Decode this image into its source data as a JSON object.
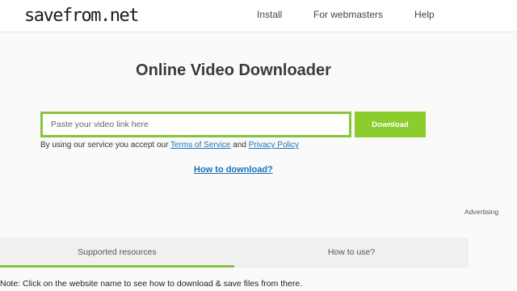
{
  "header": {
    "logo": "savefrom.net",
    "nav": {
      "install": "Install",
      "webmasters": "For webmasters",
      "help": "Help"
    }
  },
  "main": {
    "title": "Online Video Downloader",
    "input": {
      "placeholder": "Paste your video link here",
      "value": ""
    },
    "download_label": "Download",
    "terms": {
      "prefix": "By using our service you accept our",
      "terms_link": "Terms of Service",
      "and": "and",
      "privacy_link": "Privacy Policy"
    },
    "how_to_download": "How to download?"
  },
  "advertising": "Advertising",
  "tabs": {
    "supported": "Supported resources",
    "how_to_use": "How to use?",
    "active": "supported",
    "accent": "#87c43b"
  },
  "note": "Note: Click on the website name to see how to download & save files from there."
}
